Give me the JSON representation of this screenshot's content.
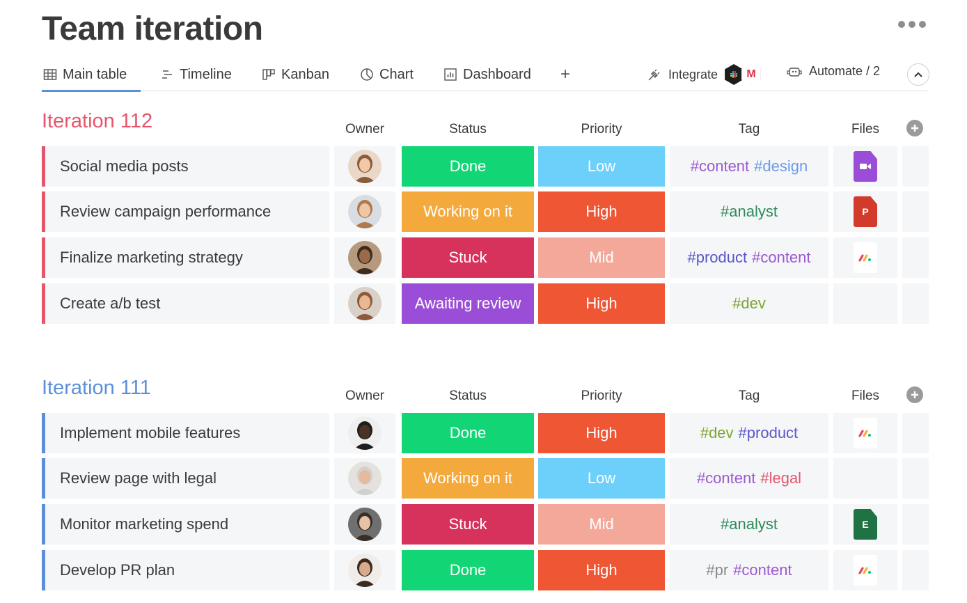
{
  "header": {
    "title": "Team iteration",
    "more_label": "More options"
  },
  "tabs": [
    {
      "label": "Main table",
      "icon": "table-icon",
      "active": true
    },
    {
      "label": "Timeline",
      "icon": "timeline-icon",
      "active": false
    },
    {
      "label": "Kanban",
      "icon": "kanban-icon",
      "active": false
    },
    {
      "label": "Chart",
      "icon": "chart-pie-icon",
      "active": false
    },
    {
      "label": "Dashboard",
      "icon": "dashboard-icon",
      "active": false
    }
  ],
  "toolbar": {
    "add_view": "+",
    "integrate_label": "Integrate",
    "automate_label": "Automate / 2",
    "gmail_glyph": "M"
  },
  "columns": {
    "owner": "Owner",
    "status": "Status",
    "priority": "Priority",
    "tag": "Tag",
    "files": "Files"
  },
  "colors": {
    "status": {
      "Done": "#12d676",
      "Working on it": "#f4a93c",
      "Stuck": "#d6325c",
      "Awaiting review": "#9a4dd6"
    },
    "priority": {
      "Low": "#6dd0fb",
      "High": "#ee5634",
      "Mid": "#f4a899"
    },
    "tags": {
      "#content": "#9b59d0",
      "#design": "#6c9be8",
      "#analyst": "#2e8a5a",
      "#product": "#5a55c9",
      "#dev": "#7fa331",
      "#legal": "#e5566c",
      "#pr": "#8a8a8a"
    },
    "files": {
      "video": "#9a4dd6",
      "ppt": "#d23b2b",
      "excel": "#1f7244"
    }
  },
  "groups": [
    {
      "title": "Iteration 112",
      "color": "#e5566c",
      "rows": [
        {
          "name": "Social media posts",
          "owner": "owner-1",
          "status": "Done",
          "priority": "Low",
          "tags": [
            "#content",
            "#design"
          ],
          "file": "video"
        },
        {
          "name": "Review campaign performance",
          "owner": "owner-2",
          "status": "Working on it",
          "priority": "High",
          "tags": [
            "#analyst"
          ],
          "file": "ppt"
        },
        {
          "name": "Finalize marketing strategy",
          "owner": "owner-3",
          "status": "Stuck",
          "priority": "Mid",
          "tags": [
            "#product",
            "#content"
          ],
          "file": "monday"
        },
        {
          "name": "Create a/b test",
          "owner": "owner-4",
          "status": "Awaiting review",
          "priority": "High",
          "tags": [
            "#dev"
          ],
          "file": ""
        }
      ]
    },
    {
      "title": "Iteration 111",
      "color": "#5b8fd9",
      "rows": [
        {
          "name": "Implement mobile features",
          "owner": "owner-5",
          "status": "Done",
          "priority": "High",
          "tags": [
            "#dev",
            "#product"
          ],
          "file": "monday"
        },
        {
          "name": "Review page with legal",
          "owner": "owner-6",
          "status": "Working on it",
          "priority": "Low",
          "tags": [
            "#content",
            "#legal"
          ],
          "file": ""
        },
        {
          "name": "Monitor marketing spend",
          "owner": "owner-7",
          "status": "Stuck",
          "priority": "Mid",
          "tags": [
            "#analyst"
          ],
          "file": "excel"
        },
        {
          "name": "Develop PR plan",
          "owner": "owner-8",
          "status": "Done",
          "priority": "High",
          "tags": [
            "#pr",
            "#content"
          ],
          "file": "monday"
        }
      ]
    }
  ],
  "file_letters": {
    "ppt": "P",
    "excel": "E"
  }
}
